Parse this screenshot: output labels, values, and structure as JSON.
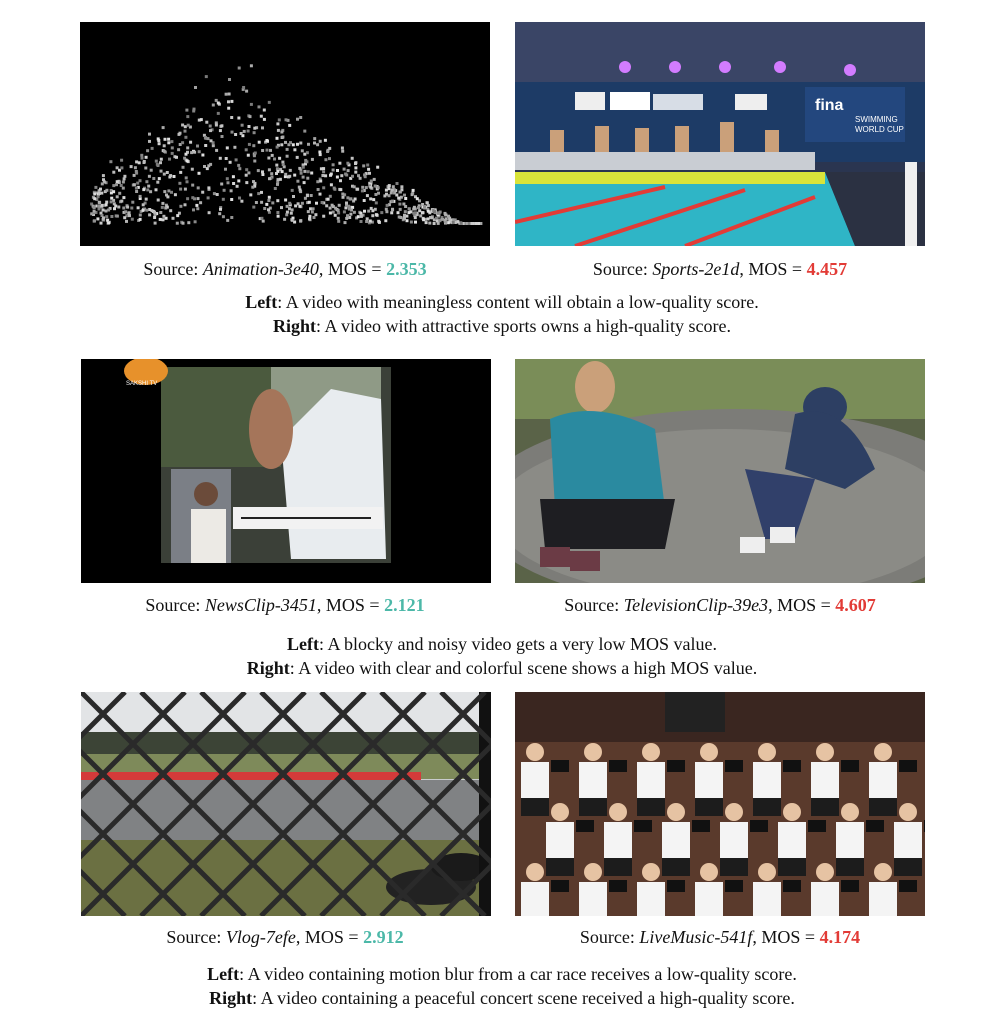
{
  "labels": {
    "source": "Source: ",
    "mos": ", MOS = ",
    "left": "Left",
    "right": "Right"
  },
  "rows": [
    {
      "left": {
        "name": "Animation-3e40",
        "mos": "2.353"
      },
      "right": {
        "name": "Sports-2e1d",
        "mos": "4.457"
      },
      "left_desc": ": A video with meaningless content will obtain a low-quality score.",
      "right_desc": ": A video with attractive sports owns a high-quality score."
    },
    {
      "left": {
        "name": "NewsClip-3451",
        "mos": "2.121"
      },
      "right": {
        "name": "TelevisionClip-39e3",
        "mos": "4.607"
      },
      "left_desc": ": A blocky and noisy video gets a very low MOS value.",
      "right_desc": ": A video with clear and colorful scene shows a high MOS value."
    },
    {
      "left": {
        "name": "Vlog-7efe",
        "mos": "2.912"
      },
      "right": {
        "name": "LiveMusic-541f",
        "mos": "4.174"
      },
      "left_desc": ": A video containing motion blur from a car race receives a low-quality score.",
      "right_desc": ": A video containing a peaceful concert scene received a high-quality score."
    }
  ],
  "image_text": {
    "fina": "fina",
    "swim_line1": "SWIMMING",
    "swim_line2": "WORLD CUP",
    "sakshi": "SAKSHI TV"
  },
  "colors": {
    "low_score": "#4cb8a8",
    "high_score": "#e23b36"
  }
}
